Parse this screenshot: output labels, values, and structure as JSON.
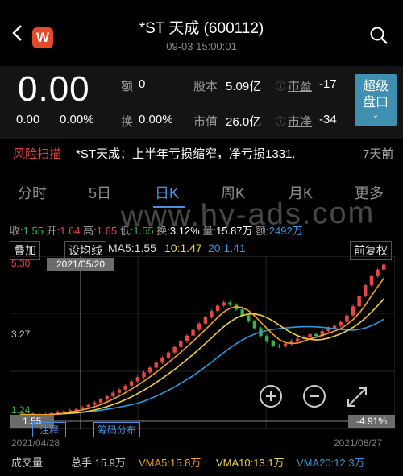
{
  "header": {
    "title": "*ST 天成 (600112)",
    "subtitle": "09-03 15:00:01",
    "logo_letter": "W"
  },
  "quote": {
    "price": "0.00",
    "change": "0.00",
    "change_pct": "0.00%",
    "amount_label": "额",
    "amount_value": "0",
    "turnover_label": "换",
    "turnover_value": "0.00%",
    "equity_label": "股本",
    "equity_value": "5.09亿",
    "mktcap_label": "市值",
    "mktcap_value": "26.0亿",
    "pe_label": "市盈",
    "pe_value": "-17",
    "pb_label": "市净",
    "pb_value": "-34",
    "order_button": [
      "超级",
      "盘口"
    ]
  },
  "risk": {
    "tag": "风险扫描",
    "headline": "*ST天成：上半年亏损缩窄，净亏损1331.",
    "days": "7天前"
  },
  "tabs": [
    "分时",
    "5日",
    "日K",
    "周K",
    "月K",
    "更多"
  ],
  "active_tab": 2,
  "stats": {
    "close_k": "收:",
    "close_v": "1.55",
    "open_k": "开:",
    "open_v": "1.64",
    "high_k": "高:",
    "high_v": "1.65",
    "low_k": "低:",
    "low_v": "1.55",
    "turn_k": "换:",
    "turn_v": "3.12%",
    "vol_k": "量:",
    "vol_v": "15.87万",
    "amt_k": "额:",
    "amt_v": "2492万"
  },
  "toolbar": {
    "overlay_button": "叠加",
    "ma_setting_button": "设均线",
    "restore_button": "前复权",
    "ma5": "MA5:1.55",
    "ma10": "10:1.47",
    "ma20": "20:1.41",
    "ma_colors": {
      "ma5": "#f0a020",
      "ma10": "#f2d23c",
      "ma20": "#2d98e0"
    }
  },
  "chart_data": {
    "type": "candlestick",
    "y_max_label": "5.30",
    "y_mid_label": "3.27",
    "y_min_label": "1.24",
    "crosshair_date": "2021/05/20",
    "crosshair_price": "1.55",
    "crosshair_pct": "-4.91%",
    "start_date": "2021/04/28",
    "end_date": "2021/08/27",
    "lower_button_left": "注释",
    "lower_button_right": "筹码分布",
    "watermark": "www.hy-ads.com",
    "closes": [
      1.42,
      1.4,
      1.42,
      1.38,
      1.42,
      1.45,
      1.48,
      1.5,
      1.52,
      1.55,
      1.6,
      1.66,
      1.72,
      1.8,
      1.88,
      1.97,
      2.05,
      2.15,
      2.26,
      2.37,
      2.49,
      2.61,
      2.74,
      2.87,
      3.0,
      3.14,
      3.28,
      3.43,
      3.58,
      3.74,
      3.9,
      4.06,
      4.2,
      4.28,
      4.22,
      4.1,
      3.95,
      3.8,
      3.62,
      3.42,
      3.28,
      3.18,
      3.15,
      3.22,
      3.3,
      3.35,
      3.4,
      3.47,
      3.42,
      3.55,
      3.62,
      3.68,
      3.78,
      3.95,
      4.18,
      4.45,
      4.72,
      4.95,
      5.12,
      5.25
    ]
  },
  "volume": {
    "label": "成交量",
    "total": "总手 15.9万",
    "vma5": "VMA5:15.8万",
    "vma10": "VMA10:13.1万",
    "vma20": "VMA20:12.3万"
  }
}
